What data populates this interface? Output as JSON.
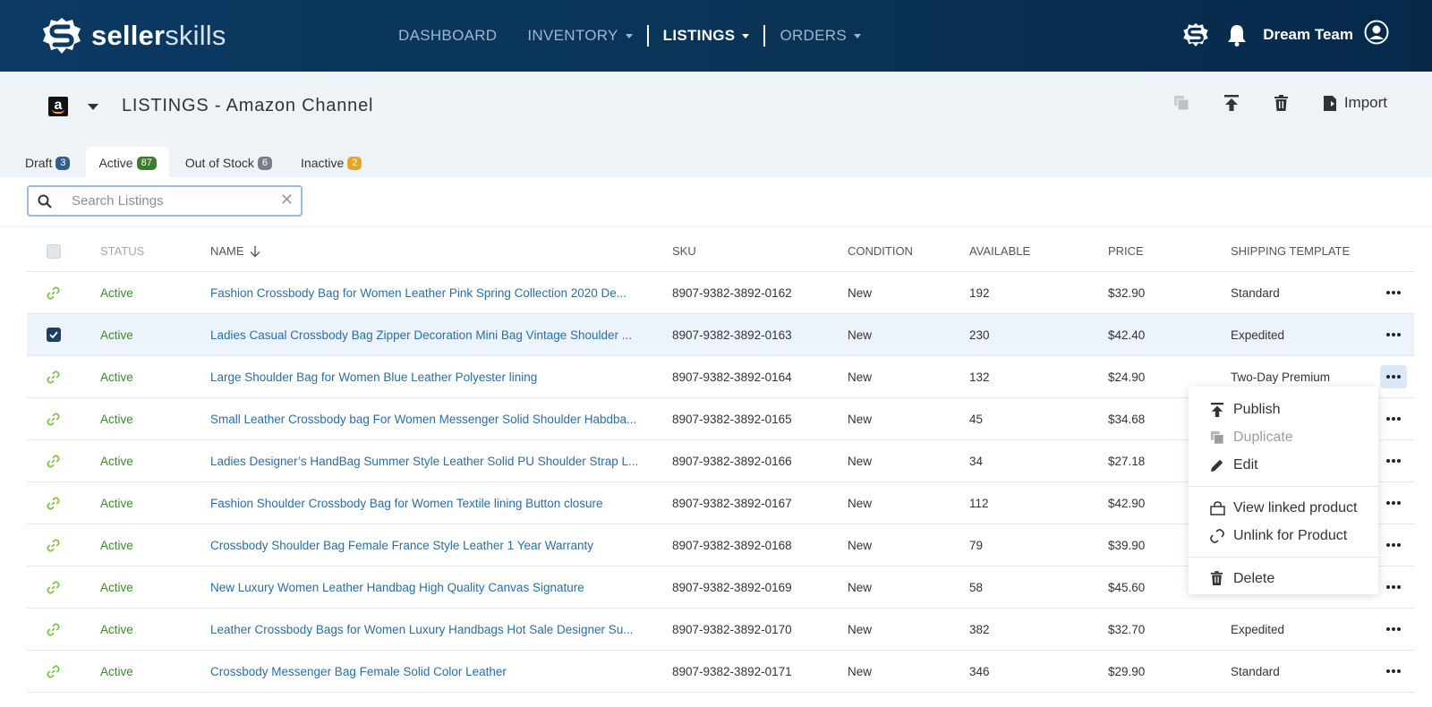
{
  "brand": {
    "bold": "seller",
    "light": "skills"
  },
  "nav": [
    {
      "label": "DASHBOARD",
      "active": false,
      "caret": false
    },
    {
      "label": "INVENTORY",
      "active": false,
      "caret": true
    },
    {
      "label": "LISTINGS",
      "active": true,
      "caret": true
    },
    {
      "label": "ORDERS",
      "active": false,
      "caret": true
    }
  ],
  "user": {
    "name": "Dream Team"
  },
  "header": {
    "title": "LISTINGS - Amazon Channel",
    "channel_letter": "a"
  },
  "toolbar": {
    "import_label": "Import"
  },
  "tabs": [
    {
      "label": "Draft",
      "count": "3",
      "color": "#2f5f8f",
      "active": false
    },
    {
      "label": "Active",
      "count": "87",
      "color": "#3b7d2c",
      "active": true
    },
    {
      "label": "Out of Stock",
      "count": "6",
      "color": "#7b7f85",
      "active": false
    },
    {
      "label": "Inactive",
      "count": "2",
      "color": "#e8a323",
      "active": false
    }
  ],
  "search": {
    "placeholder": "Search Listings",
    "value": ""
  },
  "table": {
    "headers": {
      "status": "STATUS",
      "name": "NAME",
      "sku": "SKU",
      "condition": "CONDITION",
      "available": "AVAILABLE",
      "price": "PRICE",
      "shipping": "SHIPPING TEMPLATE"
    },
    "rows": [
      {
        "status": "Active",
        "name": "Fashion Crossbody Bag for Women Leather Pink  Spring Collection 2020 De...",
        "sku": "8907-9382-3892-0162",
        "condition": "New",
        "available": "192",
        "price": "$32.90",
        "shipping": "Standard",
        "checked": false
      },
      {
        "status": "Active",
        "name": "Ladies Casual Crossbody Bag Zipper Decoration Mini Bag Vintage Shoulder ...",
        "sku": "8907-9382-3892-0163",
        "condition": "New",
        "available": "230",
        "price": "$42.40",
        "shipping": "Expedited",
        "checked": true
      },
      {
        "status": "Active",
        "name": "Large Shoulder Bag for Women Blue Leather Polyester lining",
        "sku": "8907-9382-3892-0164",
        "condition": "New",
        "available": "132",
        "price": "$24.90",
        "shipping": "Two-Day Premium",
        "checked": false,
        "menu_open": true
      },
      {
        "status": "Active",
        "name": "Small Leather Crossbody bag For Women Messenger Solid Shoulder Habdba...",
        "sku": "8907-9382-3892-0165",
        "condition": "New",
        "available": "45",
        "price": "$34.68",
        "shipping": "",
        "checked": false
      },
      {
        "status": "Active",
        "name": " Ladies Designer’s HandBag Summer Style Leather Solid PU Shoulder Strap L...",
        "sku": "8907-9382-3892-0166",
        "condition": "New",
        "available": "34",
        "price": "$27.18",
        "shipping": "",
        "checked": false
      },
      {
        "status": "Active",
        "name": "Fashion Shoulder Crossbody Bag for Women  Textile lining Button closure",
        "sku": "8907-9382-3892-0167",
        "condition": "New",
        "available": "112",
        "price": "$42.90",
        "shipping": "",
        "checked": false
      },
      {
        "status": "Active",
        "name": "Crossbody Shoulder Bag Female France Style Leather 1 Year Warranty",
        "sku": "8907-9382-3892-0168",
        "condition": "New",
        "available": "79",
        "price": "$39.90",
        "shipping": "",
        "checked": false
      },
      {
        "status": "Active",
        "name": "New Luxury Women Leather Handbag High Quality Canvas Signature",
        "sku": "8907-9382-3892-0169",
        "condition": "New",
        "available": "58",
        "price": "$45.60",
        "shipping": "",
        "checked": false
      },
      {
        "status": "Active",
        "name": "Leather Crossbody Bags for Women Luxury Handbags Hot Sale Designer Su...",
        "sku": "8907-9382-3892-0170",
        "condition": "New",
        "available": "382",
        "price": "$32.70",
        "shipping": "Expedited",
        "checked": false
      },
      {
        "status": "Active",
        "name": "Crossbody Messenger Bag Female Solid Color Leather",
        "sku": "8907-9382-3892-0171",
        "condition": "New",
        "available": "346",
        "price": "$29.90",
        "shipping": "Standard",
        "checked": false
      }
    ]
  },
  "row_menu": {
    "publish": "Publish",
    "duplicate": "Duplicate",
    "edit": "Edit",
    "view_linked": "View linked product",
    "unlink": "Unlink for Product",
    "delete": "Delete"
  },
  "colors": {
    "navy": "#0b3a63",
    "status_green": "#3b8a2c",
    "link_blue": "#2b6ea3",
    "link_icon_green": "#7cc242"
  }
}
